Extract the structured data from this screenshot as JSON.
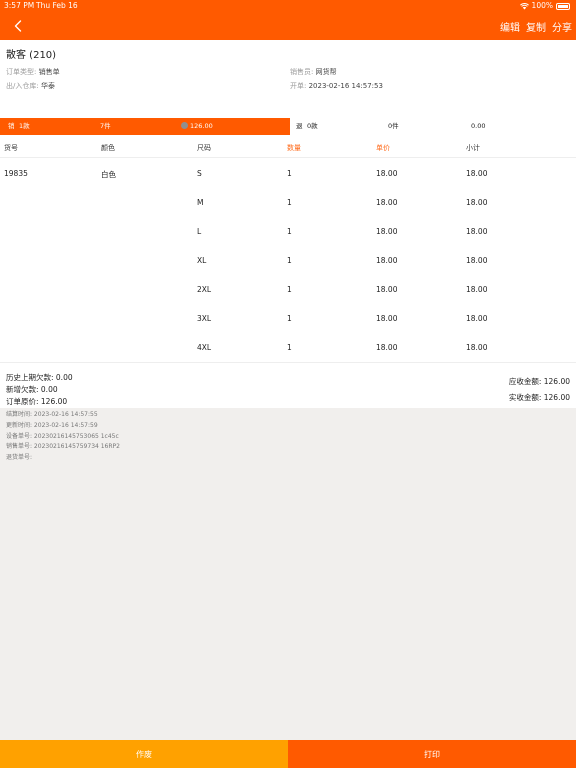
{
  "status": {
    "time": "3:57 PM",
    "date": "Thu Feb 16",
    "battery": "100%"
  },
  "nav": {
    "edit": "编辑",
    "copy": "复制",
    "share": "分享"
  },
  "order": {
    "customer": "散客 (210)",
    "type_label": "订单类型:",
    "type_value": "销售单",
    "warehouse_label": "出/入仓库:",
    "warehouse_value": "华泰",
    "clerk_label": "销售员:",
    "clerk_value": "网货帮",
    "opened_label": "开单:",
    "opened_value": "2023-02-16 14:57:53"
  },
  "summary": {
    "sale_label": "销",
    "sale_styles": "1款",
    "sale_pieces": "7件",
    "sale_amount": "126.00",
    "return_label": "退",
    "return_styles": "0款",
    "return_pieces": "0件",
    "return_amount": "0.00"
  },
  "table": {
    "headers": [
      "货号",
      "颜色",
      "尺码",
      "数量",
      "单价",
      "小计"
    ],
    "rows": [
      {
        "sku": "19835",
        "color": "白色",
        "size": "S",
        "qty": "1",
        "price": "18.00",
        "subtotal": "18.00"
      },
      {
        "sku": "",
        "color": "",
        "size": "M",
        "qty": "1",
        "price": "18.00",
        "subtotal": "18.00"
      },
      {
        "sku": "",
        "color": "",
        "size": "L",
        "qty": "1",
        "price": "18.00",
        "subtotal": "18.00"
      },
      {
        "sku": "",
        "color": "",
        "size": "XL",
        "qty": "1",
        "price": "18.00",
        "subtotal": "18.00"
      },
      {
        "sku": "",
        "color": "",
        "size": "2XL",
        "qty": "1",
        "price": "18.00",
        "subtotal": "18.00"
      },
      {
        "sku": "",
        "color": "",
        "size": "3XL",
        "qty": "1",
        "price": "18.00",
        "subtotal": "18.00"
      },
      {
        "sku": "",
        "color": "",
        "size": "4XL",
        "qty": "1",
        "price": "18.00",
        "subtotal": "18.00"
      }
    ]
  },
  "totals": {
    "prev_debt": "历史上期欠款:  0.00",
    "new_debt": "新增欠款:  0.00",
    "original": "订单原价:  126.00",
    "receivable": "应收金额:  126.00",
    "received": "实收金额:  126.00"
  },
  "meta": {
    "settle_time": "结算时间:   2023-02-16 14:57:55",
    "update_time": "更新时间:   2023-02-16 14:57:59",
    "device_no": "设备单号:   20230216145753065 1c45c",
    "sale_no": "销售单号:   20230216145759734 16RP2",
    "return_no": "退货单号:"
  },
  "actions": {
    "void": "作废",
    "print": "打印"
  },
  "colors": {
    "accent": "#ff5a00",
    "void_button": "#ffa100"
  }
}
